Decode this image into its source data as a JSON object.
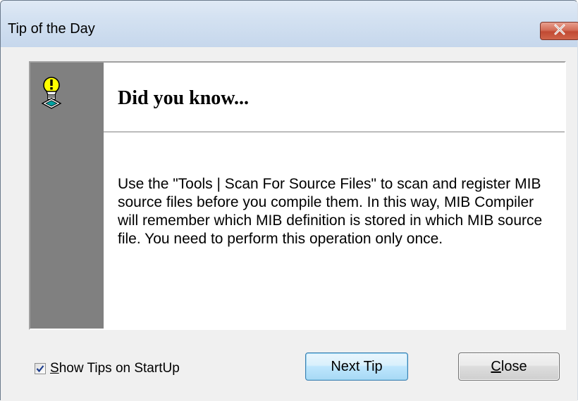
{
  "window": {
    "title": "Tip of the Day",
    "close_icon": "close-x-icon"
  },
  "tip": {
    "icon": "lightbulb-icon",
    "headline": "Did you know...",
    "body": "Use the \"Tools | Scan For Source Files\" to scan and register MIB source files before you compile them. In this way, MIB Compiler will remember which MIB definition is stored in which MIB source file. You need to perform this operation only once."
  },
  "footer": {
    "show_tips_label_mnemonic": "S",
    "show_tips_label_rest": "how Tips on StartUp",
    "show_tips_checked": true,
    "next_tip_label": "Next Tip",
    "close_label_mnemonic": "C",
    "close_label_rest": "lose"
  },
  "colors": {
    "close_button": "#c14a33",
    "tip_strip": "#808080",
    "next_button_border": "#3c7fb1"
  }
}
